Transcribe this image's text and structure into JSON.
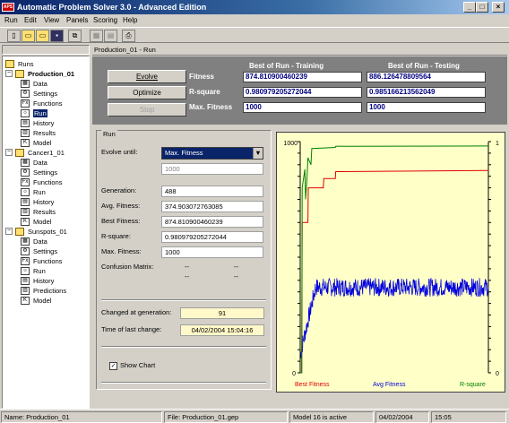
{
  "window": {
    "title": "Automatic Problem Solver 3.0 - Advanced Edition",
    "icon_text": "APS"
  },
  "menu": [
    "Run",
    "Edit",
    "View",
    "Panels",
    "Scoring",
    "Help"
  ],
  "toolbar_icons": [
    "new-icon",
    "open-icon",
    "open-folder-icon",
    "save-icon",
    "copy-icon",
    "grid-icon",
    "table-icon",
    "print-icon"
  ],
  "tree": {
    "root": "Runs",
    "projects": [
      {
        "name": "Production_01",
        "items": [
          "Data",
          "Settings",
          "Functions",
          "Run",
          "History",
          "Results",
          "Model"
        ]
      },
      {
        "name": "Cancer1_01",
        "items": [
          "Data",
          "Settings",
          "Functions",
          "Run",
          "History",
          "Results",
          "Model"
        ]
      },
      {
        "name": "Sunspots_01",
        "items": [
          "Data",
          "Settings",
          "Functions",
          "Run",
          "History",
          "Predictions",
          "Model"
        ]
      }
    ]
  },
  "breadcrumb": "Production_01 - Run",
  "buttons": {
    "evolve": "Evolve",
    "optimize": "Optimize",
    "stop": "Stop"
  },
  "stats": {
    "col_training": "Best of Run - Training",
    "col_testing": "Best of Run - Testing",
    "rows": [
      {
        "label": "Fitness",
        "training": "874.810900460239",
        "testing": "886.126478809564"
      },
      {
        "label": "R-square",
        "training": "0.980979205272044",
        "testing": "0.985166213562049"
      },
      {
        "label": "Max. Fitness",
        "training": "1000",
        "testing": "1000"
      }
    ]
  },
  "run": {
    "group_title": "Run",
    "evolve_until_label": "Evolve until:",
    "evolve_until_value": "Max. Fitness",
    "target_value": "1000",
    "fields": [
      {
        "label": "Generation:",
        "value": "488"
      },
      {
        "label": "Avg. Fitness:",
        "value": "374.903072763085"
      },
      {
        "label": "Best Fitness:",
        "value": "874.810900460239"
      },
      {
        "label": "R-square:",
        "value": "0.980979205272044"
      },
      {
        "label": "Max. Fitness:",
        "value": "1000"
      }
    ],
    "confusion_label": "Confusion Matrix:",
    "confusion": [
      "--",
      "--",
      "--",
      "--"
    ],
    "changed_label": "Changed at generation:",
    "changed_value": "91",
    "time_label": "Time of last change:",
    "time_value": "04/02/2004 15:04:16",
    "show_chart_label": "Show Chart",
    "show_chart_checked": true
  },
  "chart_data": {
    "type": "line",
    "left_axis": {
      "min": 0,
      "max": 1000,
      "ticks": [
        "1000",
        "0"
      ]
    },
    "right_axis": {
      "min": 0,
      "max": 1,
      "ticks": [
        "1",
        "0"
      ]
    },
    "legend": [
      {
        "name": "Best Fitness",
        "color": "#e00000"
      },
      {
        "name": "Avg Fitness",
        "color": "#0000e0"
      },
      {
        "name": "R-square",
        "color": "#008000"
      }
    ],
    "generations": 488,
    "series": [
      {
        "name": "Best Fitness",
        "axis": "left",
        "points": [
          [
            0,
            0
          ],
          [
            4,
            0
          ],
          [
            5,
            650
          ],
          [
            20,
            650
          ],
          [
            21,
            800
          ],
          [
            60,
            800
          ],
          [
            61,
            840
          ],
          [
            91,
            840
          ],
          [
            92,
            870
          ],
          [
            488,
            875
          ]
        ]
      },
      {
        "name": "R-square",
        "axis": "right",
        "points": [
          [
            0,
            0
          ],
          [
            4,
            0
          ],
          [
            5,
            0.8
          ],
          [
            12,
            0.88
          ],
          [
            14,
            0.75
          ],
          [
            18,
            0.85
          ],
          [
            20,
            0.93
          ],
          [
            28,
            0.9
          ],
          [
            30,
            0.97
          ],
          [
            91,
            0.975
          ],
          [
            92,
            0.98
          ],
          [
            488,
            0.981
          ]
        ]
      },
      {
        "name": "Avg Fitness",
        "axis": "left",
        "mean": 370,
        "noise": 40,
        "start": 80,
        "ramp_generations": 40
      }
    ]
  },
  "status": {
    "name": "Name: Production_01",
    "file": "File: Production_01.gep",
    "model": "Model 16 is active",
    "date": "04/02/2004",
    "time": "15:05"
  },
  "colors": {
    "title_start": "#0a246a",
    "panel": "#808080",
    "value_text": "#000080",
    "chart_bg": "#ffffc8"
  }
}
